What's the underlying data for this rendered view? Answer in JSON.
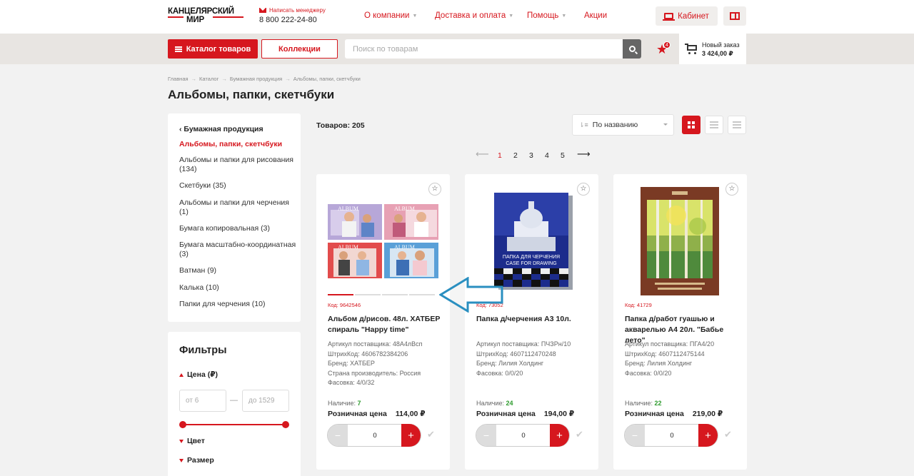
{
  "header": {
    "logo_line1": "КАНЦЕЛЯРСКИЙ",
    "logo_line2": "МИР",
    "manager_link": "Написать менеджеру",
    "phone": "8 800 222-24-80",
    "nav": [
      "О компании",
      "Доставка и оплата",
      "Помощь",
      "Акции"
    ],
    "cabinet": "Кабинет"
  },
  "subbar": {
    "catalog_button": "Каталог товаров",
    "collections_button": "Коллекции",
    "search_placeholder": "Поиск по товарам",
    "favorites_count": "4",
    "cart_label": "Новый заказ",
    "cart_total": "3 424,00 ₽"
  },
  "breadcrumbs": [
    "Главная",
    "Каталог",
    "Бумажная продукция",
    "Альбомы, папки, скетчбуки"
  ],
  "breadcrumb_sep": "→",
  "page_title": "Альбомы, папки, скетчбуки",
  "sidebar": {
    "back_label": "Бумажная продукция",
    "categories": [
      "Альбомы, папки, скетчбуки",
      "Альбомы и папки для рисования (134)",
      "Скетбуки (35)",
      "Альбомы и папки для черчения (1)",
      "Бумага копировальная (3)",
      "Бумага масштабно-координатная (3)",
      "Ватман (9)",
      "Калька (10)",
      "Папки для черчения (10)"
    ]
  },
  "filters": {
    "title": "Фильтры",
    "price_label": "Цена (₽)",
    "price_from_placeholder": "от 6",
    "price_to_placeholder": "до 1529",
    "price_sep": "—",
    "color_label": "Цвет",
    "size_label": "Размер"
  },
  "toolbar": {
    "count_text": "Товаров: 205",
    "sort_value": "По названию"
  },
  "pagination": {
    "pages": [
      "1",
      "2",
      "3",
      "4",
      "5"
    ],
    "current": "1",
    "prev": "⟵",
    "next": "⟶"
  },
  "products": [
    {
      "code": "Код: 9642546",
      "name": "Альбом д/рисов. 48л. ХАТБЕР спираль \"Happy time\"",
      "attrs": [
        "Артикул поставщика: 48А4лВсп",
        "ШтрихКод: 4606782384206",
        "Бренд: ХАТБЕР",
        "Страна производитель: Россия",
        "Фасовка: 4/0/32"
      ],
      "availability_label": "Наличие: ",
      "availability": "7",
      "price_label": "Розничная цена",
      "price": "114,00 ₽",
      "qty": "0"
    },
    {
      "code": "Код: 73052",
      "name": "Папка д/черчения А3 10л.",
      "attrs": [
        "Артикул поставщика: ПЧЗРн/10",
        "ШтрихКод: 4607112470248",
        "Бренд: Лилия Холдинг",
        "Фасовка: 0/0/20"
      ],
      "availability_label": "Наличие: ",
      "availability": "24",
      "price_label": "Розничная цена",
      "price": "194,00 ₽",
      "qty": "0"
    },
    {
      "code": "Код: 41729",
      "name": "Папка д/работ гуашью и акварелью А4 20л. \"Бабье лето\"",
      "attrs": [
        "Артикул поставщика: ПГА4/20",
        "ШтрихКод: 4607112475144",
        "Бренд: Лилия Холдинг",
        "Фасовка: 0/0/20"
      ],
      "availability_label": "Наличие: ",
      "availability": "22",
      "price_label": "Розничная цена",
      "price": "219,00 ₽",
      "qty": "0"
    }
  ],
  "image_text": {
    "album": "ALBUM",
    "folder_ru": "ПАПКА ДЛЯ ЧЕРЧЕНИЯ",
    "folder_en": "CASE FOR DRAWING"
  },
  "colors": {
    "accent": "#d6171e",
    "available": "#2e9b2e",
    "annotation_arrow": "#2a8fc0"
  }
}
